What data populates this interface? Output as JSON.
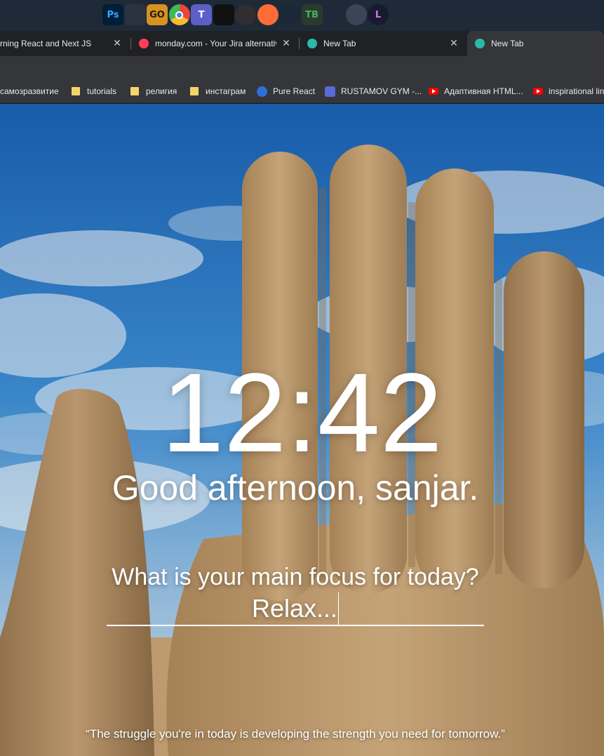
{
  "taskbar": {
    "icons": [
      {
        "name": "photoshop-icon",
        "label": "Ps",
        "color": "#001e36",
        "fg": "#31a8ff"
      },
      {
        "name": "game-skull-icon",
        "label": "",
        "color": "#2b3340",
        "fg": "#ffffff"
      },
      {
        "name": "csgo-icon",
        "label": "GO",
        "color": "#d9911f",
        "fg": "#1b1b1b"
      },
      {
        "name": "chrome-icon",
        "label": "",
        "color": "#e8453c",
        "fg": "#ffffff"
      },
      {
        "name": "teams-icon",
        "label": "T",
        "color": "#5b5fc7",
        "fg": "#ffffff"
      },
      {
        "name": "need-for-speed-icon",
        "label": "",
        "color": "#111111",
        "fg": "#e02020"
      },
      {
        "name": "obs-icon",
        "label": "",
        "color": "#302e31",
        "fg": "#ffffff"
      },
      {
        "name": "postman-icon",
        "label": "",
        "color": "#ff6c37",
        "fg": "#ffffff"
      },
      {
        "name": "steam-icon",
        "label": "",
        "color": "#1b2838",
        "fg": "#ffffff"
      },
      {
        "name": "tb-icon",
        "label": "TB",
        "color": "#2b3a2e",
        "fg": "#46b25b"
      },
      {
        "name": "vscode-icon",
        "label": "",
        "color": "#1e2a38",
        "fg": "#23a9f2"
      },
      {
        "name": "counter-strike-icon",
        "label": "",
        "color": "#3a4655",
        "fg": "#c9d4de"
      },
      {
        "name": "lightshot-icon",
        "label": "L",
        "color": "#1a1a2e",
        "fg": "#c77dff"
      }
    ]
  },
  "tabs": [
    {
      "title": "rning React and Next JS",
      "favicon_color": null
    },
    {
      "title": "monday.com - Your Jira alternative",
      "favicon_color": "#ff3d57"
    },
    {
      "title": "New Tab",
      "favicon_color": "#2bb9a9"
    },
    {
      "title": "New Tab",
      "favicon_color": "#2bb9a9"
    }
  ],
  "bookmarks": [
    {
      "label": "самозразвитие",
      "type": "none"
    },
    {
      "label": "tutorials",
      "type": "folder"
    },
    {
      "label": "религия",
      "type": "folder"
    },
    {
      "label": "инстаграм",
      "type": "folder"
    },
    {
      "label": "Pure React",
      "type": "round",
      "color": "#2f6fd8"
    },
    {
      "label": "RUSTAMOV GYM -...",
      "type": "round",
      "color": "#5a6ad6"
    },
    {
      "label": "Адаптивная HTML...",
      "type": "youtube"
    },
    {
      "label": "inspirational lin",
      "type": "youtube"
    }
  ],
  "main": {
    "clock": "12:42",
    "greeting": "Good afternoon, sanjar.",
    "focus_question": "What is your main focus for today?",
    "focus_value": "Relax...",
    "quote": "“The struggle you're in today is developing the strength you need for tomorrow.”"
  }
}
